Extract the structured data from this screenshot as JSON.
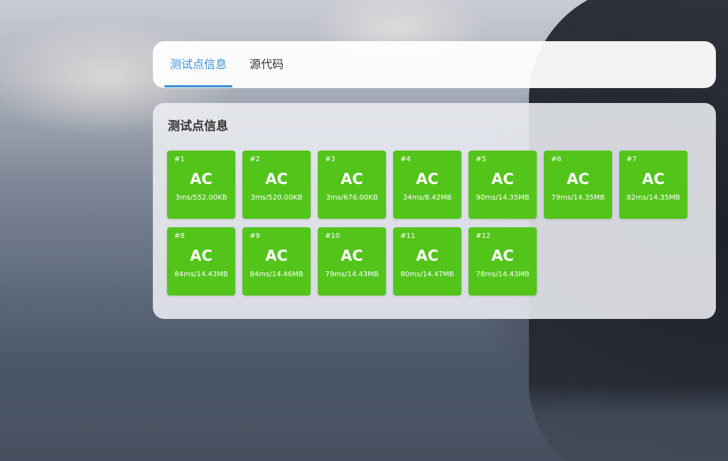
{
  "tabs": [
    {
      "label": "测试点信息",
      "active": true
    },
    {
      "label": "源代码",
      "active": false
    }
  ],
  "panel": {
    "title": "测试点信息"
  },
  "accent_color": "#3a8fd6",
  "status_color": "#52c41a",
  "test_cases": [
    {
      "index": "#1",
      "status": "AC",
      "stats": "3ms/552.00KB"
    },
    {
      "index": "#2",
      "status": "AC",
      "stats": "3ms/520.00KB"
    },
    {
      "index": "#3",
      "status": "AC",
      "stats": "3ms/676.00KB"
    },
    {
      "index": "#4",
      "status": "AC",
      "stats": "34ms/8.42MB"
    },
    {
      "index": "#5",
      "status": "AC",
      "stats": "90ms/14.35MB"
    },
    {
      "index": "#6",
      "status": "AC",
      "stats": "79ms/14.35MB"
    },
    {
      "index": "#7",
      "status": "AC",
      "stats": "82ms/14.35MB"
    },
    {
      "index": "#8",
      "status": "AC",
      "stats": "84ms/14.43MB"
    },
    {
      "index": "#9",
      "status": "AC",
      "stats": "84ms/14.46MB"
    },
    {
      "index": "#10",
      "status": "AC",
      "stats": "79ms/14.43MB"
    },
    {
      "index": "#11",
      "status": "AC",
      "stats": "80ms/14.47MB"
    },
    {
      "index": "#12",
      "status": "AC",
      "stats": "78ms/14.43MB"
    }
  ]
}
